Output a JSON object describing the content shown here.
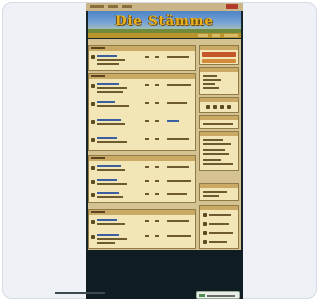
{
  "browser": {
    "banner_title": "Die Stämme"
  },
  "colors": {
    "page_background": "#15252a",
    "banner_sky": "#4c84c4",
    "banner_title": "#e9b21f",
    "content_parchment": "#f3e6b6",
    "section_header": "#c9a964",
    "accent_button": "#c4562a"
  },
  "footer": {
    "badge_icon": "status-badge-icon"
  }
}
